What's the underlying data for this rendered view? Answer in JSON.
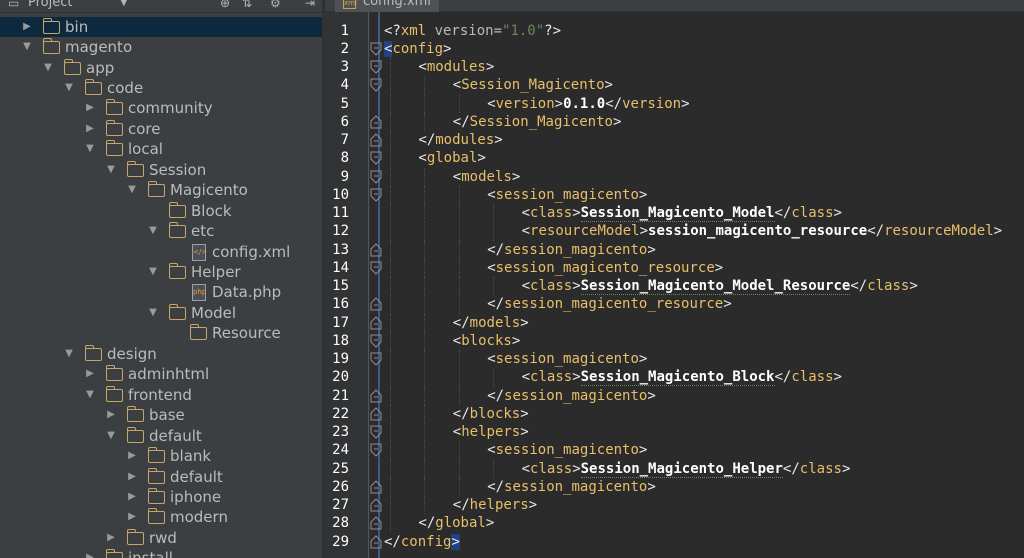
{
  "project_panel": {
    "title": "Project",
    "tree": [
      {
        "label": "bin",
        "kind": "folder",
        "level": 1,
        "expanded": false,
        "selected": true
      },
      {
        "label": "magento",
        "kind": "folder",
        "level": 1,
        "expanded": true
      },
      {
        "label": "app",
        "kind": "folder",
        "level": 2,
        "expanded": true
      },
      {
        "label": "code",
        "kind": "folder",
        "level": 3,
        "expanded": true
      },
      {
        "label": "community",
        "kind": "folder",
        "level": 4,
        "expanded": false
      },
      {
        "label": "core",
        "kind": "folder",
        "level": 4,
        "expanded": false
      },
      {
        "label": "local",
        "kind": "folder",
        "level": 4,
        "expanded": true
      },
      {
        "label": "Session",
        "kind": "folder",
        "level": 5,
        "expanded": true
      },
      {
        "label": "Magicento",
        "kind": "folder",
        "level": 6,
        "expanded": true
      },
      {
        "label": "Block",
        "kind": "folder",
        "level": 7,
        "expanded": null
      },
      {
        "label": "etc",
        "kind": "folder",
        "level": 7,
        "expanded": true
      },
      {
        "label": "config.xml",
        "kind": "xml-file",
        "level": 8,
        "expanded": null
      },
      {
        "label": "Helper",
        "kind": "folder",
        "level": 7,
        "expanded": true
      },
      {
        "label": "Data.php",
        "kind": "php-file",
        "level": 8,
        "expanded": null
      },
      {
        "label": "Model",
        "kind": "folder",
        "level": 7,
        "expanded": true
      },
      {
        "label": "Resource",
        "kind": "folder",
        "level": 8,
        "expanded": null
      },
      {
        "label": "design",
        "kind": "folder",
        "level": 3,
        "expanded": true
      },
      {
        "label": "adminhtml",
        "kind": "folder",
        "level": 4,
        "expanded": false
      },
      {
        "label": "frontend",
        "kind": "folder",
        "level": 4,
        "expanded": true
      },
      {
        "label": "base",
        "kind": "folder",
        "level": 5,
        "expanded": false
      },
      {
        "label": "default",
        "kind": "folder",
        "level": 5,
        "expanded": true
      },
      {
        "label": "blank",
        "kind": "folder",
        "level": 6,
        "expanded": false
      },
      {
        "label": "default",
        "kind": "folder",
        "level": 6,
        "expanded": false
      },
      {
        "label": "iphone",
        "kind": "folder",
        "level": 6,
        "expanded": false
      },
      {
        "label": "modern",
        "kind": "folder",
        "level": 6,
        "expanded": false
      },
      {
        "label": "rwd",
        "kind": "folder",
        "level": 5,
        "expanded": false
      },
      {
        "label": "install",
        "kind": "folder",
        "level": 4,
        "expanded": false
      }
    ]
  },
  "editor": {
    "tab_label": "config.xml",
    "lines": [
      {
        "n": "1",
        "depth": 0,
        "fold": "none",
        "segs": [
          [
            "p",
            "<?"
          ],
          [
            "tag",
            "xml "
          ],
          [
            "attr",
            "version="
          ],
          [
            "val",
            "\"1.0\""
          ],
          [
            "p",
            "?>"
          ]
        ]
      },
      {
        "n": "2",
        "depth": 0,
        "fold": "open",
        "segs": [
          [
            "hl",
            "<"
          ],
          [
            "tag",
            "config"
          ],
          [
            "p",
            ">"
          ]
        ]
      },
      {
        "n": "3",
        "depth": 1,
        "fold": "open",
        "segs": [
          [
            "p",
            "<"
          ],
          [
            "tag",
            "modules"
          ],
          [
            "p",
            ">"
          ]
        ]
      },
      {
        "n": "4",
        "depth": 2,
        "fold": "open",
        "segs": [
          [
            "p",
            "<"
          ],
          [
            "tag",
            "Session_Magicento"
          ],
          [
            "p",
            ">"
          ]
        ]
      },
      {
        "n": "5",
        "depth": 3,
        "fold": "none",
        "segs": [
          [
            "p",
            "<"
          ],
          [
            "tag",
            "version"
          ],
          [
            "p",
            ">"
          ],
          [
            "txt",
            "0.1.0"
          ],
          [
            "p",
            "</"
          ],
          [
            "tag",
            "version"
          ],
          [
            "p",
            ">"
          ]
        ]
      },
      {
        "n": "6",
        "depth": 2,
        "fold": "close",
        "segs": [
          [
            "p",
            "</"
          ],
          [
            "tag",
            "Session_Magicento"
          ],
          [
            "p",
            ">"
          ]
        ]
      },
      {
        "n": "7",
        "depth": 1,
        "fold": "close",
        "segs": [
          [
            "p",
            "</"
          ],
          [
            "tag",
            "modules"
          ],
          [
            "p",
            ">"
          ]
        ]
      },
      {
        "n": "8",
        "depth": 1,
        "fold": "open",
        "segs": [
          [
            "p",
            "<"
          ],
          [
            "tag",
            "global"
          ],
          [
            "p",
            ">"
          ]
        ]
      },
      {
        "n": "9",
        "depth": 2,
        "fold": "open",
        "segs": [
          [
            "p",
            "<"
          ],
          [
            "tag",
            "models"
          ],
          [
            "p",
            ">"
          ]
        ]
      },
      {
        "n": "10",
        "depth": 3,
        "fold": "open",
        "segs": [
          [
            "p",
            "<"
          ],
          [
            "tag",
            "session_magicento"
          ],
          [
            "p",
            ">"
          ]
        ]
      },
      {
        "n": "11",
        "depth": 4,
        "fold": "none",
        "segs": [
          [
            "p",
            "<"
          ],
          [
            "tag",
            "class"
          ],
          [
            "p",
            ">"
          ],
          [
            "txtw",
            "Session_Magicento_Model"
          ],
          [
            "p",
            "</"
          ],
          [
            "tag",
            "class"
          ],
          [
            "p",
            ">"
          ]
        ]
      },
      {
        "n": "12",
        "depth": 4,
        "fold": "none",
        "segs": [
          [
            "p",
            "<"
          ],
          [
            "tag",
            "resourceModel"
          ],
          [
            "p",
            ">"
          ],
          [
            "txt",
            "session_magicento_resource"
          ],
          [
            "p",
            "</"
          ],
          [
            "tag",
            "resourceModel"
          ],
          [
            "p",
            ">"
          ]
        ]
      },
      {
        "n": "13",
        "depth": 3,
        "fold": "close",
        "segs": [
          [
            "p",
            "</"
          ],
          [
            "tag",
            "session_magicento"
          ],
          [
            "p",
            ">"
          ]
        ]
      },
      {
        "n": "14",
        "depth": 3,
        "fold": "open",
        "segs": [
          [
            "p",
            "<"
          ],
          [
            "tag",
            "session_magicento_resource"
          ],
          [
            "p",
            ">"
          ]
        ]
      },
      {
        "n": "15",
        "depth": 4,
        "fold": "none",
        "segs": [
          [
            "p",
            "<"
          ],
          [
            "tag",
            "class"
          ],
          [
            "p",
            ">"
          ],
          [
            "txtw",
            "Session_Magicento_Model_Resource"
          ],
          [
            "p",
            "</"
          ],
          [
            "tag",
            "class"
          ],
          [
            "p",
            ">"
          ]
        ]
      },
      {
        "n": "16",
        "depth": 3,
        "fold": "close",
        "segs": [
          [
            "p",
            "</"
          ],
          [
            "tag",
            "session_magicento_resource"
          ],
          [
            "p",
            ">"
          ]
        ]
      },
      {
        "n": "17",
        "depth": 2,
        "fold": "close",
        "segs": [
          [
            "p",
            "</"
          ],
          [
            "tag",
            "models"
          ],
          [
            "p",
            ">"
          ]
        ]
      },
      {
        "n": "18",
        "depth": 2,
        "fold": "open",
        "segs": [
          [
            "p",
            "<"
          ],
          [
            "tag",
            "blocks"
          ],
          [
            "p",
            ">"
          ]
        ]
      },
      {
        "n": "19",
        "depth": 3,
        "fold": "open",
        "segs": [
          [
            "p",
            "<"
          ],
          [
            "tag",
            "session_magicento"
          ],
          [
            "p",
            ">"
          ]
        ]
      },
      {
        "n": "20",
        "depth": 4,
        "fold": "none",
        "segs": [
          [
            "p",
            "<"
          ],
          [
            "tag",
            "class"
          ],
          [
            "p",
            ">"
          ],
          [
            "txtw",
            "Session_Magicento_Block"
          ],
          [
            "p",
            "</"
          ],
          [
            "tag",
            "class"
          ],
          [
            "p",
            ">"
          ]
        ]
      },
      {
        "n": "21",
        "depth": 3,
        "fold": "close",
        "segs": [
          [
            "p",
            "</"
          ],
          [
            "tag",
            "session_magicento"
          ],
          [
            "p",
            ">"
          ]
        ]
      },
      {
        "n": "22",
        "depth": 2,
        "fold": "close",
        "segs": [
          [
            "p",
            "</"
          ],
          [
            "tag",
            "blocks"
          ],
          [
            "p",
            ">"
          ]
        ]
      },
      {
        "n": "23",
        "depth": 2,
        "fold": "open",
        "segs": [
          [
            "p",
            "<"
          ],
          [
            "tag",
            "helpers"
          ],
          [
            "p",
            ">"
          ]
        ]
      },
      {
        "n": "24",
        "depth": 3,
        "fold": "open",
        "segs": [
          [
            "p",
            "<"
          ],
          [
            "tag",
            "session_magicento"
          ],
          [
            "p",
            ">"
          ]
        ]
      },
      {
        "n": "25",
        "depth": 4,
        "fold": "none",
        "segs": [
          [
            "p",
            "<"
          ],
          [
            "tag",
            "class"
          ],
          [
            "p",
            ">"
          ],
          [
            "txtw",
            "Session_Magicento_Helper"
          ],
          [
            "p",
            "</"
          ],
          [
            "tag",
            "class"
          ],
          [
            "p",
            ">"
          ]
        ]
      },
      {
        "n": "26",
        "depth": 3,
        "fold": "close",
        "segs": [
          [
            "p",
            "</"
          ],
          [
            "tag",
            "session_magicento"
          ],
          [
            "p",
            ">"
          ]
        ]
      },
      {
        "n": "27",
        "depth": 2,
        "fold": "close",
        "segs": [
          [
            "p",
            "</"
          ],
          [
            "tag",
            "helpers"
          ],
          [
            "p",
            ">"
          ]
        ]
      },
      {
        "n": "28",
        "depth": 1,
        "fold": "close",
        "segs": [
          [
            "p",
            "</"
          ],
          [
            "tag",
            "global"
          ],
          [
            "p",
            ">"
          ]
        ]
      },
      {
        "n": "29",
        "depth": 0,
        "fold": "close",
        "segs": [
          [
            "p",
            "</"
          ],
          [
            "tag",
            "config"
          ],
          [
            "hl",
            ">"
          ]
        ]
      }
    ]
  },
  "colors": {
    "tag": "#e8bf6a",
    "text_value": "#ffffff",
    "selection": "#0d293e",
    "folder": "#c8a66a"
  },
  "icons": {
    "project": "project-icon",
    "settings": "gear-icon",
    "locate": "target-icon",
    "collapse": "collapse-icon",
    "hide": "minimize-icon"
  }
}
